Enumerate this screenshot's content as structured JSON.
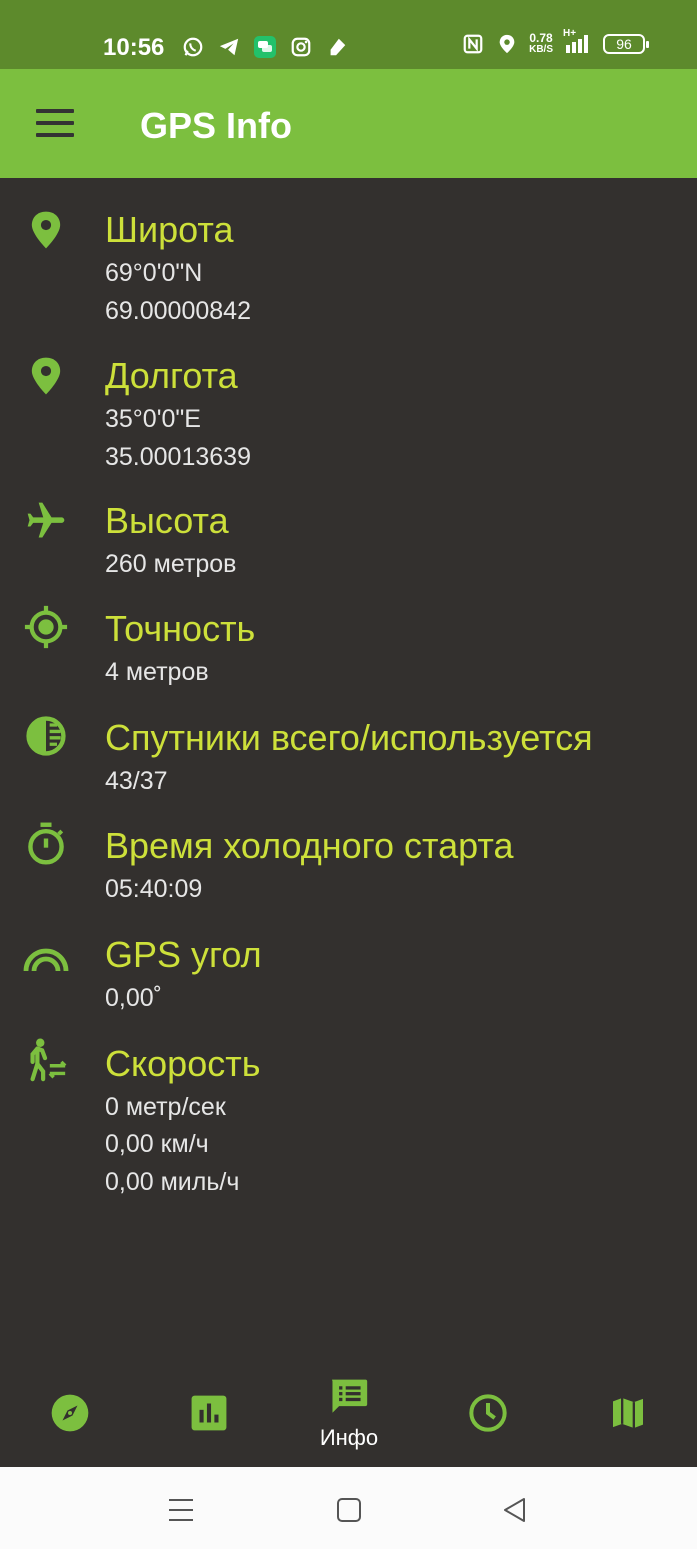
{
  "status_bar": {
    "time": "10:56",
    "net_speed": "0.78",
    "net_speed_unit": "KB/S",
    "network": "H+",
    "battery": "96"
  },
  "app": {
    "title": "GPS Info",
    "colors": {
      "appbar": "#7cbf3f",
      "statusbar": "#5d8a2c",
      "accent_text": "#cde03a",
      "icon": "#7cbf3f",
      "background": "#33302e"
    }
  },
  "items": [
    {
      "icon": "location-pin-icon",
      "title": "Широта",
      "lines": [
        "69°0'0\"N",
        "69.00000842"
      ]
    },
    {
      "icon": "location-pin-icon",
      "title": "Долгота",
      "lines": [
        "35°0'0\"E",
        "35.00013639"
      ]
    },
    {
      "icon": "airplane-icon",
      "title": "Высота",
      "lines": [
        "260 метров"
      ]
    },
    {
      "icon": "gps-fixed-icon",
      "title": "Точность",
      "lines": [
        "4 метров"
      ]
    },
    {
      "icon": "contrast-icon",
      "title": "Спутники всего/используется",
      "lines": [
        "43/37"
      ]
    },
    {
      "icon": "timer-icon",
      "title": "Время холодного старта",
      "lines": [
        "05:40:09"
      ]
    },
    {
      "icon": "arc-icon",
      "title": "GPS угол",
      "lines": [
        "0,00˚"
      ]
    },
    {
      "icon": "walking-icon",
      "title": "Скорость",
      "lines": [
        "0 метр/сек",
        "0,00 км/ч",
        "0,00 миль/ч"
      ]
    }
  ],
  "bottom_nav": {
    "items": [
      {
        "icon": "compass-icon",
        "label": ""
      },
      {
        "icon": "bar-chart-icon",
        "label": ""
      },
      {
        "icon": "info-list-icon",
        "label": "Инфо",
        "selected": true
      },
      {
        "icon": "clock-icon",
        "label": ""
      },
      {
        "icon": "map-icon",
        "label": ""
      }
    ]
  }
}
